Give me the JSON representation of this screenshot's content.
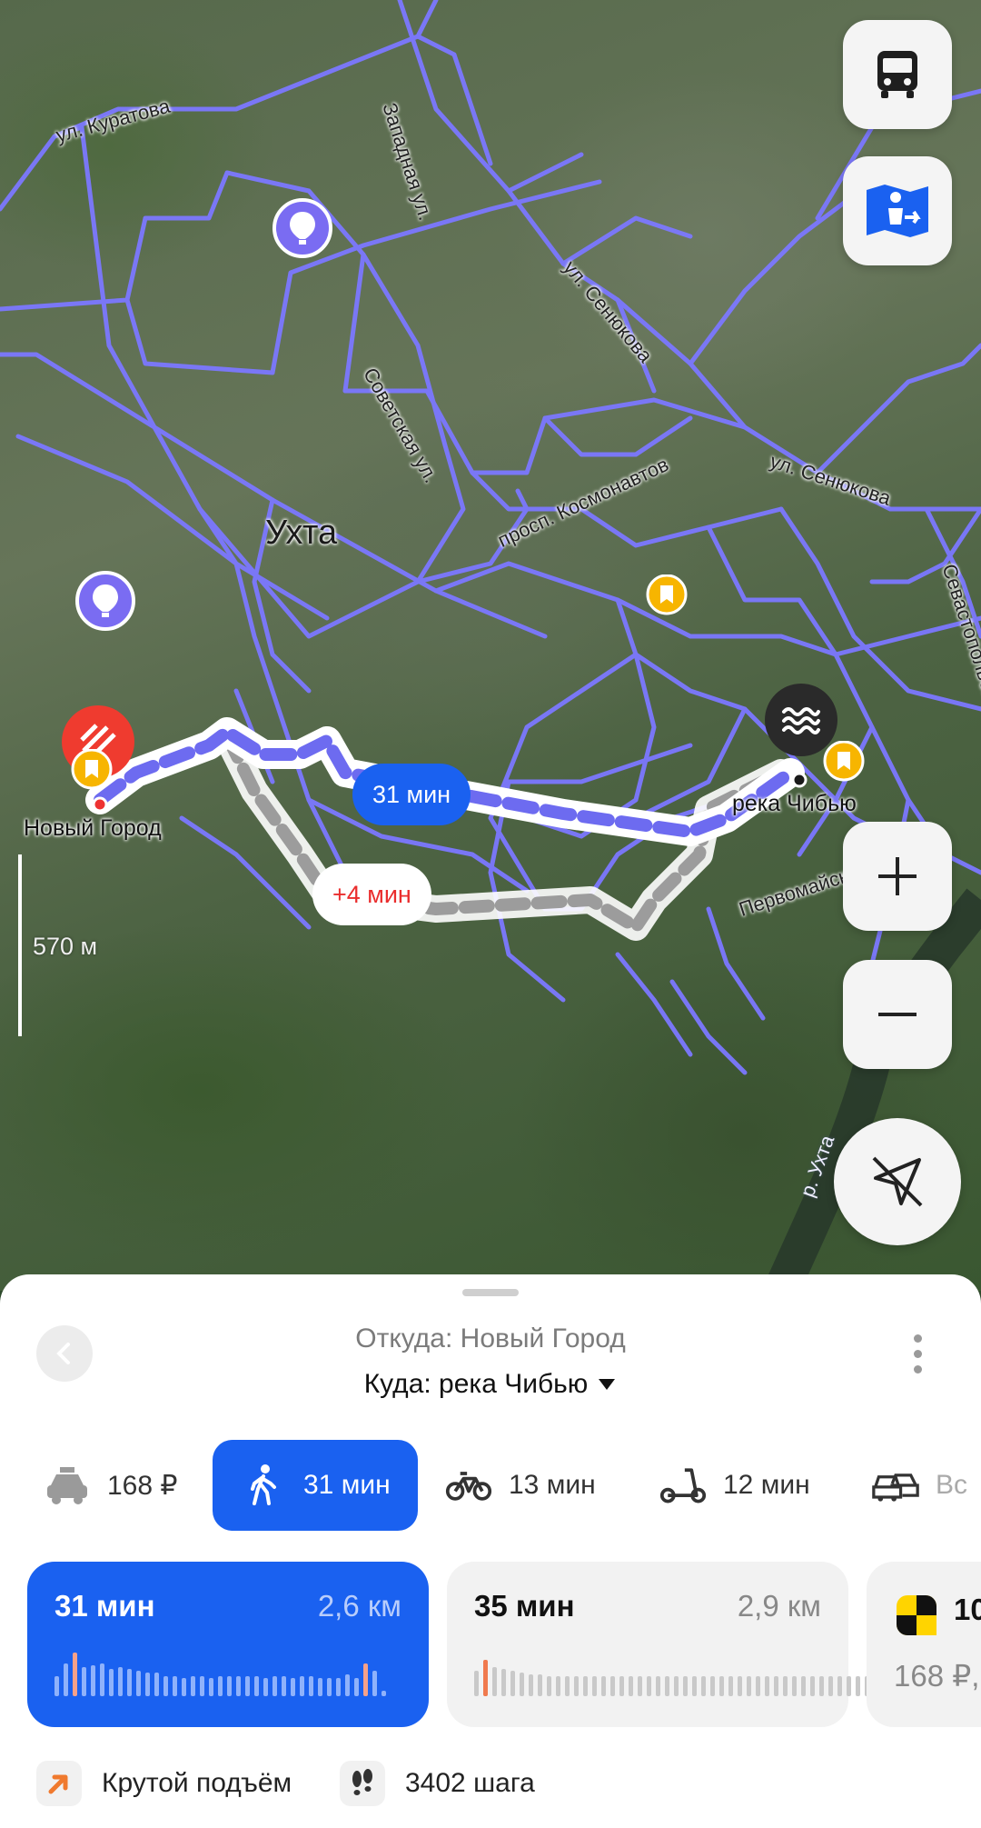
{
  "map": {
    "city_label": "Ухта",
    "streets": {
      "kuratova": "ул. Куратова",
      "zapadnaya": "Западная ул.",
      "senyukova_1": "ул. Сенюкова",
      "senyukova_2": "ул. Сенюкова",
      "sovetskaya": "Советская ул.",
      "kosmonavtov": "просп. Космонавтов",
      "sevastopolskaya": "Севастопольская ул.",
      "pervomayskaya": "Первомайская ул.",
      "river_ukhta": "р. Ухта"
    },
    "start_point_label": "Новый Город",
    "end_point_label": "река Чибью",
    "route_time_chip": "31 мин",
    "alt_route_chip": "+4 мин",
    "scale_label": "570 м",
    "route_color": "#6d6bf0",
    "accent_color": "#1a61f0"
  },
  "sheet": {
    "from_text": "Откуда: Новый Город",
    "to_text": "Куда: река Чибью",
    "modes": [
      {
        "icon": "taxi-icon",
        "label": "168 ₽"
      },
      {
        "icon": "walk-icon",
        "label": "31 мин"
      },
      {
        "icon": "bike-icon",
        "label": "13 мин"
      },
      {
        "icon": "scooter-icon",
        "label": "12 мин"
      },
      {
        "icon": "all-transport-icon",
        "label": "Вс"
      }
    ],
    "routes": [
      {
        "time": "31 мин",
        "distance": "2,6 км"
      },
      {
        "time": "35 мин",
        "distance": "2,9 км"
      },
      {
        "time": "10",
        "price": "168 ₽,"
      }
    ],
    "features": [
      {
        "icon": "steep-climb-icon",
        "label": "Крутой подъём"
      },
      {
        "icon": "footsteps-icon",
        "label": "3402 шага"
      }
    ]
  }
}
